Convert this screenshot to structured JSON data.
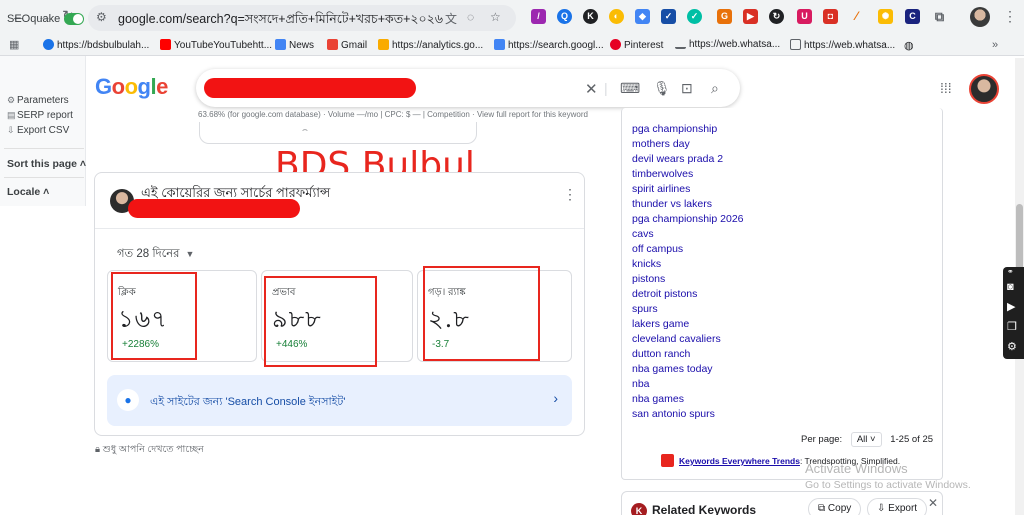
{
  "browser": {
    "url": "google.com/search?q=সংসদে+প্রতি+মিনিটে+খরচ+কত+২০২৬&s...",
    "extensions": [
      "pen-extension",
      "seoquake-extension",
      "k-extension",
      "keywords-extension",
      "shield-extension",
      "check-extension",
      "check-mark-extension",
      "g-extension",
      "tube-extension",
      "refresh-extension",
      "ublock-extension",
      "youtube-extension",
      "slash-extension",
      "gear-extension",
      "c-extension",
      "puzzle-icon"
    ],
    "bookmarks": [
      {
        "label": "https://bdsbulbulah..."
      },
      {
        "label": "YouTubeYouTubehtt..."
      },
      {
        "label": "News"
      },
      {
        "label": "Gmail"
      },
      {
        "label": "https://analytics.go..."
      },
      {
        "label": "https://search.googl..."
      },
      {
        "label": "Pinterest"
      },
      {
        "label": "https://web.whatsa..."
      },
      {
        "label": "https://web.whatsa..."
      }
    ]
  },
  "seoquake": {
    "title": "SEOquake",
    "enabled": true,
    "links": [
      "Parameters",
      "SERP report",
      "Export CSV"
    ],
    "sort_label": "Sort this page",
    "locale_label": "Locale"
  },
  "google": {
    "logo": "Google",
    "seoquake_meta": "63.68%  (for google.com database)  ·  Volume  —/mo  |  CPC: $ —  |  Competition  ·  View full report for this keyword"
  },
  "overlay_text": "BDS Bulbul",
  "performance": {
    "title": "এই কোয়েরির জন্য সার্চের পারফর্ম্যান্স",
    "period": "গত 28 দিনের",
    "metrics": [
      {
        "label": "ক্লিক",
        "value": "১৬৭",
        "change": "+2286%"
      },
      {
        "label": "প্রভাব",
        "value": "৯৮৮",
        "change": "+446%"
      },
      {
        "label": "গড়। র‍্যাঙ্ক",
        "value": "২.৮",
        "change": "-3.7"
      }
    ],
    "insight": "এই সাইটের জন্য 'Search Console ইনসাইট'",
    "private_note": "শুধু আপনি দেখতে পাচ্ছেন"
  },
  "trends": {
    "items": [
      "pga championship",
      "mothers day",
      "devil wears prada 2",
      "timberwolves",
      "spirit airlines",
      "thunder vs lakers",
      "pga championship 2026",
      "cavs",
      "off campus",
      "knicks",
      "pistons",
      "detroit pistons",
      "spurs",
      "lakers game",
      "cleveland cavaliers",
      "dutton ranch",
      "nba games today",
      "nba",
      "nba games",
      "san antonio spurs"
    ],
    "per_page_label": "Per page:",
    "per_page_value": "All",
    "range": "1-25 of 25",
    "footer_link": "Keywords Everywhere Trends",
    "footer_text": ": Trendspotting, Simplified."
  },
  "windows_notice": {
    "title": "Activate Windows",
    "subtitle": "Go to Settings to activate Windows."
  },
  "related": {
    "title": "Related Keywords",
    "copy": "Copy",
    "export": "Export"
  },
  "colors": {
    "accent_red": "#e8261e",
    "link_blue": "#1a0dab",
    "positive_green": "#188038"
  }
}
